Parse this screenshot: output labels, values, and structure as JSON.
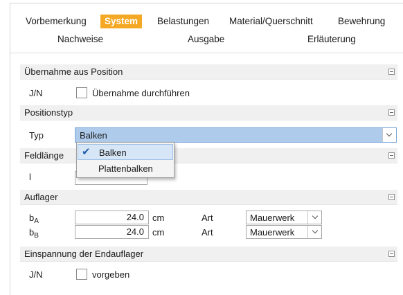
{
  "tabs": {
    "row1": [
      "Vorbemerkung",
      "System",
      "Belastungen",
      "Material/Querschnitt",
      "Bewehrung"
    ],
    "row2": [
      "Nachweise",
      "Ausgabe",
      "Erläuterung"
    ],
    "active": "System",
    "active_color": "#f4a823"
  },
  "sections": {
    "uebernahme": {
      "title": "Übernahme aus Position",
      "row_label": "J/N",
      "checkbox_label": "Übernahme durchführen",
      "checked": false
    },
    "positionstyp": {
      "title": "Positionstyp",
      "row_label": "Typ",
      "selected": "Balken",
      "options": [
        "Balken",
        "Plattenbalken"
      ]
    },
    "feldlaenge": {
      "title": "Feldlänge",
      "row_label": "l"
    },
    "auflager": {
      "title": "Auflager",
      "rows": [
        {
          "symbol": "b",
          "subscript": "A",
          "value": "24.0",
          "unit": "cm",
          "art_label": "Art",
          "art_value": "Mauerwerk"
        },
        {
          "symbol": "b",
          "subscript": "B",
          "value": "24.0",
          "unit": "cm",
          "art_label": "Art",
          "art_value": "Mauerwerk"
        }
      ]
    },
    "einspannung": {
      "title": "Einspannung der Endauflager",
      "row_label": "J/N",
      "checkbox_label": "vorgeben",
      "checked": false
    }
  },
  "icons": {
    "collapse": "minus-box-icon",
    "dropdown": "chevron-down-icon",
    "check": "checkmark-icon"
  }
}
